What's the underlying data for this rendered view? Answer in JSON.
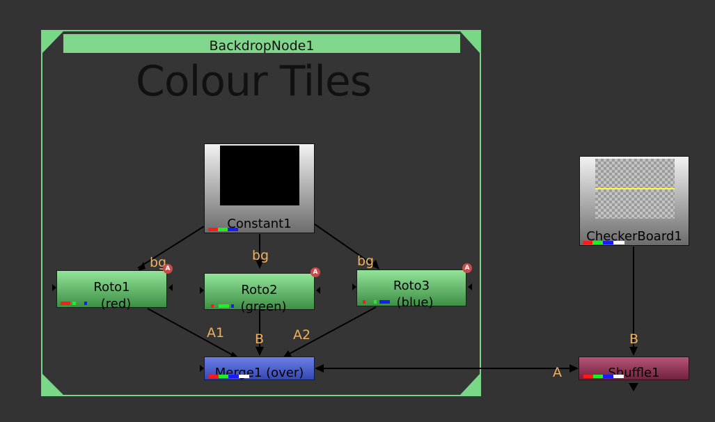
{
  "backdrop": {
    "label": "BackdropNode1",
    "title": "Colour Tiles"
  },
  "nodes": {
    "constant": {
      "label": "Constant1"
    },
    "checkerboard": {
      "label": "CheckerBoard1"
    },
    "roto1": {
      "line1": "Roto1",
      "line2": "(red)",
      "badge": "A"
    },
    "roto2": {
      "line1": "Roto2",
      "line2": "(green)",
      "badge": "A"
    },
    "roto3": {
      "line1": "Roto3",
      "line2": "(blue)",
      "badge": "A"
    },
    "merge": {
      "label": "Merge1 (over)"
    },
    "shuffle": {
      "label": "Shuffle1"
    }
  },
  "edge_labels": {
    "roto1_bg": "bg",
    "roto2_bg": "bg",
    "roto3_bg": "bg",
    "merge_a1": "A1",
    "merge_b": "B",
    "merge_a2": "A2",
    "shuffle_b": "B",
    "shuffle_a": "A"
  },
  "colors": {
    "backdrop_border": "#78d888",
    "backdrop_label_bg": "#80d68a",
    "edge_label": "#f0b060",
    "channel_red": "#ff1a1a",
    "channel_green": "#22ee22",
    "channel_blue": "#1a1aff",
    "channel_white": "#ffffff",
    "checker_line": "#ffff33"
  }
}
